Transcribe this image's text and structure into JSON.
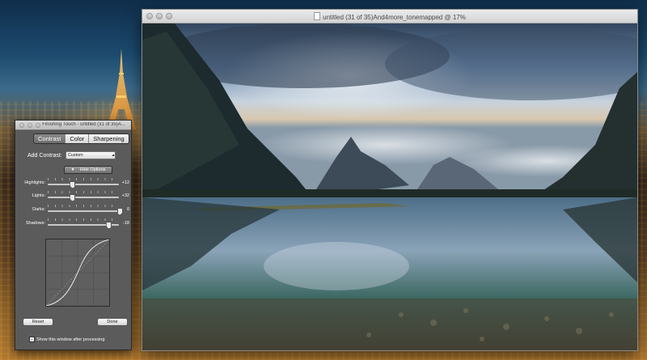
{
  "image_window": {
    "title": "untitled (31 of 35)And4more_tonemapped @ 17%"
  },
  "panel": {
    "title": "Finishing Touch - untitled (31 of 35)A...",
    "tabs": [
      {
        "label": "Contrast",
        "active": true
      },
      {
        "label": "Color",
        "active": false
      },
      {
        "label": "Sharpening",
        "active": false
      }
    ],
    "add_contrast_label": "Add Contrast:",
    "add_contrast_value": "Custom",
    "hide_options_label": "Hide Options",
    "sliders": [
      {
        "label": "Highlights:",
        "value": "+12",
        "fraction": 0.34
      },
      {
        "label": "Lights:",
        "value": "+32",
        "fraction": 0.34
      },
      {
        "label": "Darks:",
        "value": "0",
        "fraction": 1.0
      },
      {
        "label": "Shadows:",
        "value": "-18",
        "fraction": 0.85
      }
    ],
    "reset_label": "Reset",
    "done_label": "Done",
    "show_window_label": "Show this window after processing",
    "show_window_checked": true
  }
}
